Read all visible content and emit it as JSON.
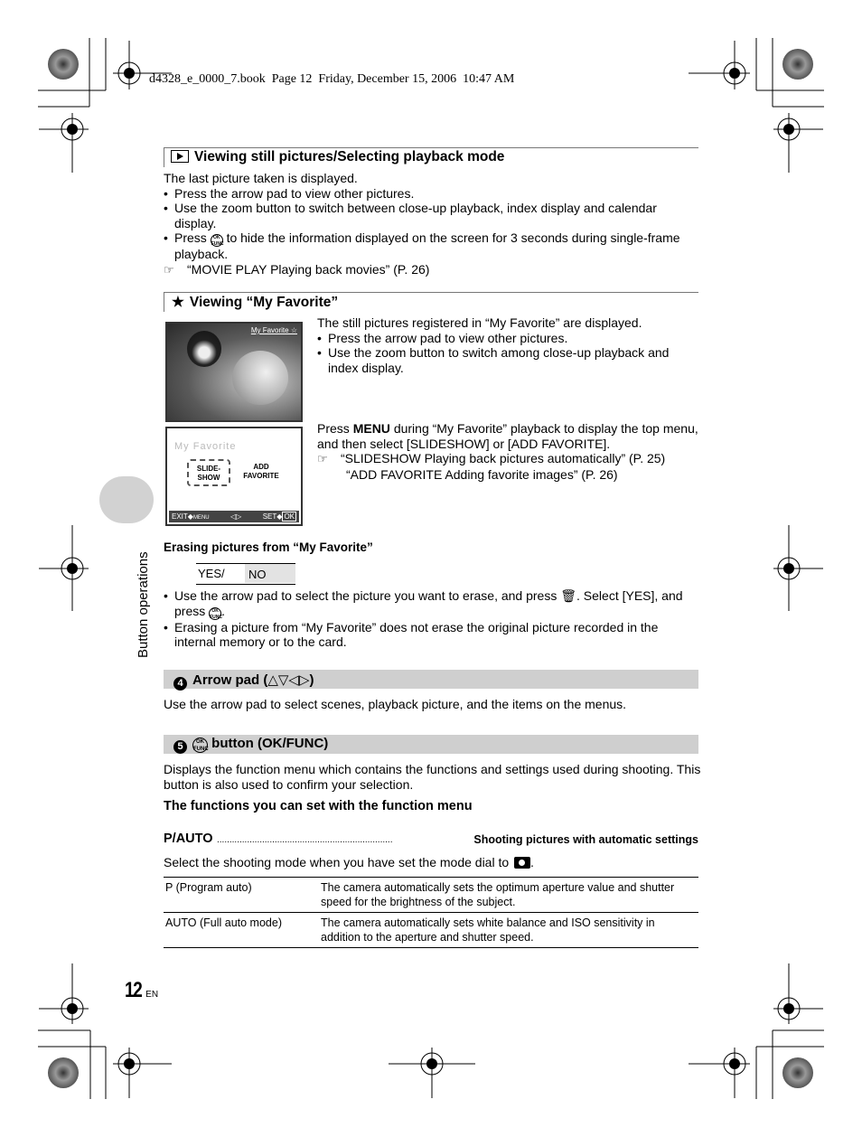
{
  "print_header": "d4328_e_0000_7.book  Page 12  Friday, December 15, 2006  10:47 AM",
  "side_tab": "Button operations",
  "page_number": "12",
  "page_lang": "EN",
  "section_playback": {
    "icon": "play-icon",
    "title": "Viewing still pictures/Selecting playback mode",
    "intro": "The last picture taken is displayed.",
    "bullets": [
      "Press the arrow pad to view other pictures.",
      "Use the zoom button to switch between close-up playback, index display and calendar display."
    ],
    "bullet3_pre": "Press",
    "bullet3_post": "to hide the information displayed on the screen for 3 seconds during single-frame playback.",
    "reference": "“MOVIE PLAY Playing back movies” (P. 26)"
  },
  "section_favorite": {
    "icon": "star-icon",
    "title": "Viewing “My Favorite”",
    "intro": "The still pictures registered in “My Favorite” are displayed.",
    "bullets": [
      "Press the arrow pad to view other pictures.",
      "Use the zoom button to switch among close-up playback and index display."
    ],
    "photo_label": "My Favorite ☆",
    "menu_pre": "Press",
    "menu_key": "MENU",
    "menu_post": "during “My Favorite” playback to display the top menu, and then select [SLIDESHOW] or [ADD FAVORITE].",
    "references": [
      "“SLIDESHOW Playing back pictures automatically” (P. 25)",
      "“ADD FAVORITE Adding favorite images” (P. 26)"
    ],
    "screen": {
      "title": "My Favorite",
      "option1": "SLIDE-\nSHOW",
      "option1_a": "SLIDE-",
      "option1_b": "SHOW",
      "option2_a": "ADD",
      "option2_b": "FAVORITE",
      "exit": "EXIT",
      "menu": "MENU",
      "set": "SET",
      "ok": "OK"
    }
  },
  "erasing": {
    "title": "Erasing pictures from “My Favorite”",
    "yes": "YES/",
    "no": "NO",
    "bullet1_pre": "Use the arrow pad to select the picture you want to erase, and press",
    "bullet1_mid": ". Select [YES], and press",
    "bullet1_end": ".",
    "bullet2": "Erasing a picture from “My Favorite” does not erase the original picture recorded in the internal memory or to the card."
  },
  "section_arrow": {
    "number": "4",
    "title": "Arrow pad (",
    "arrows": "△▽◁▷",
    "title_end": ")",
    "text": "Use the arrow pad to select scenes, playback picture, and the items on the menus."
  },
  "section_ok": {
    "number": "5",
    "title": "button (OK/FUNC)",
    "text": "Displays the function menu which contains the functions and settings used during shooting. This button is also used to confirm your selection.",
    "subheading": "The functions you can set with the function menu",
    "pauto_label": "P/AUTO",
    "pauto_leader": "......................................................................",
    "pauto_desc": "Shooting pictures with automatic settings",
    "mode_text": "Select the shooting mode when you have set the mode dial to",
    "table": [
      {
        "mode": "P (Program auto)",
        "desc": "The camera automatically sets the optimum aperture value and shutter speed for the brightness of the subject."
      },
      {
        "mode": "AUTO (Full auto mode)",
        "desc": "The camera automatically sets white balance and ISO sensitivity in addition to the aperture and shutter speed."
      }
    ]
  },
  "ok_icon_text": "OK\nFUNC"
}
